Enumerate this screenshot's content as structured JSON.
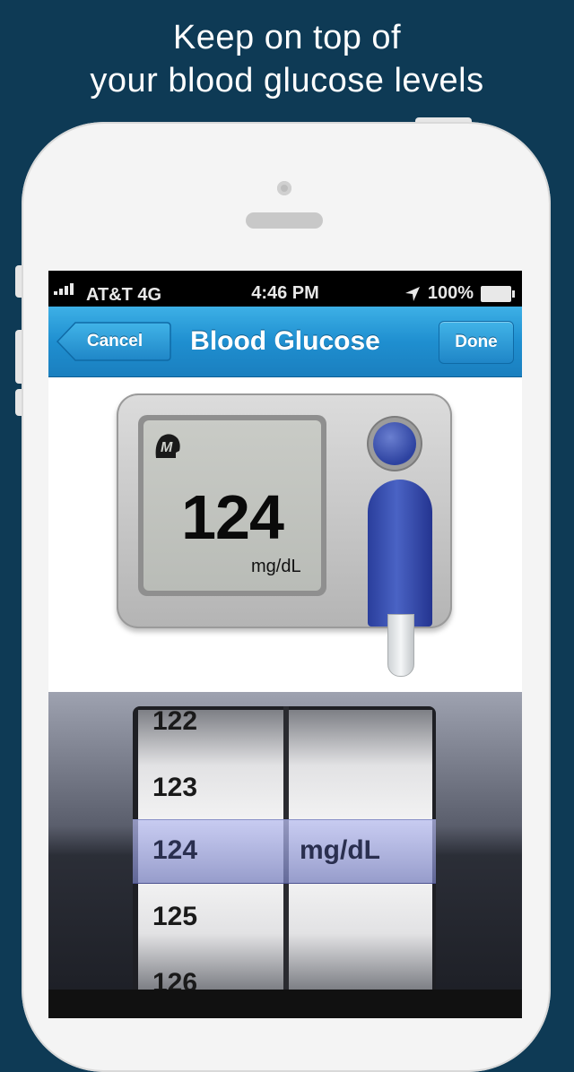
{
  "headline": {
    "line1": "Keep on top of",
    "line2": "your blood glucose levels"
  },
  "status_bar": {
    "carrier": "AT&T  4G",
    "time": "4:46 PM",
    "battery": "100%"
  },
  "nav": {
    "title": "Blood Glucose",
    "cancel_label": "Cancel",
    "done_label": "Done"
  },
  "meter": {
    "logo_letter": "M",
    "value": "124",
    "unit": "mg/dL"
  },
  "picker": {
    "values": [
      "122",
      "123",
      "124",
      "125",
      "126"
    ],
    "selected_value": "124",
    "unit": "mg/dL"
  },
  "colors": {
    "background": "#0e3a55",
    "nav_blue": "#1f8fd0",
    "selection": "#9aa2dc"
  }
}
